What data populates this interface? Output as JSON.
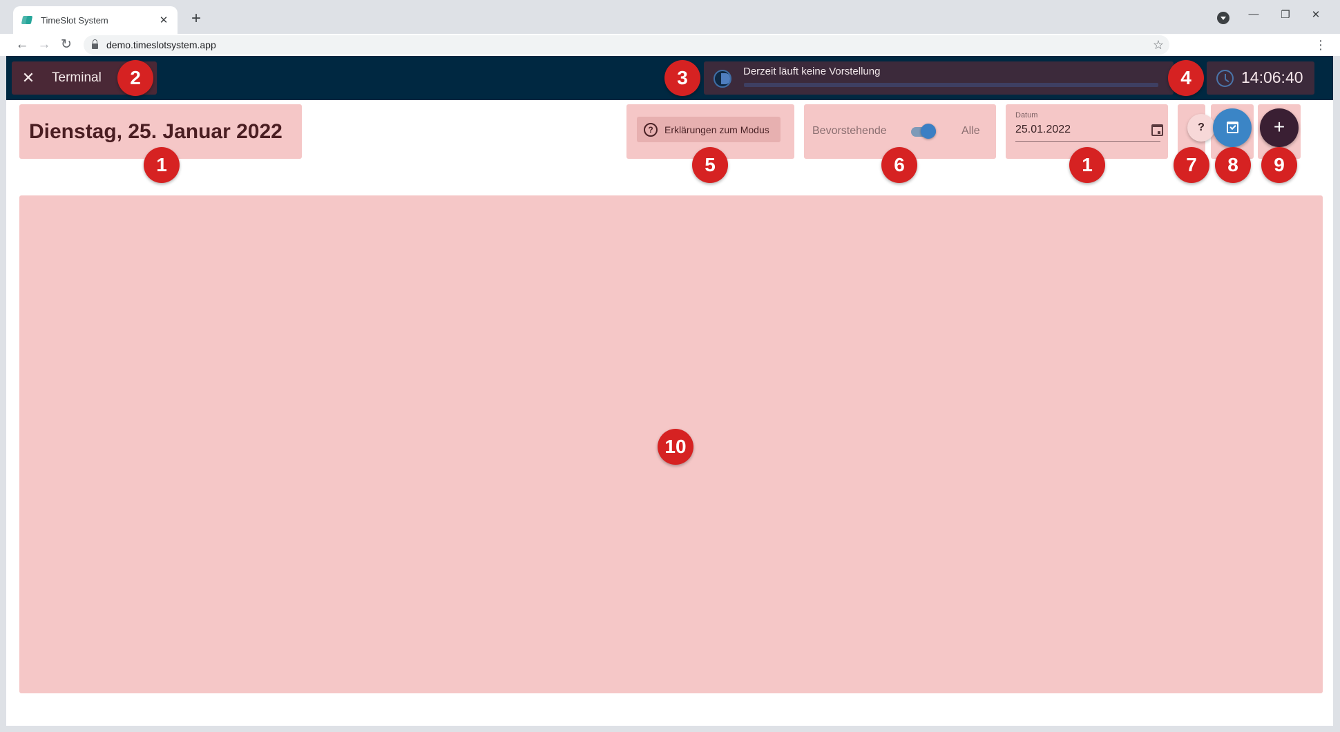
{
  "browser": {
    "tab_title": "TimeSlot System",
    "url": "demo.timeslotsystem.app"
  },
  "appbar": {
    "terminal_label": "Terminal",
    "show_status": "Derzeit läuft keine Vorstellung",
    "clock_time": "14:06:40"
  },
  "header": {
    "date_title": "Dienstag, 25. Januar 2022",
    "mode_button_label": "Erklärungen zum Modus",
    "toggle_left_label": "Bevorstehende",
    "toggle_right_label": "Alle",
    "toggle_on": true,
    "date_field_label": "Datum",
    "date_field_value": "25.01.2022",
    "help_label": "?",
    "add_label": "+"
  },
  "badges": [
    "1",
    "2",
    "3",
    "4",
    "5",
    "6",
    "1",
    "7",
    "8",
    "9",
    "10"
  ],
  "colors": {
    "appbar": "#002841",
    "highlight": "#f5c7c7",
    "badge": "#d62222",
    "accent_blue": "#3b85c6"
  }
}
